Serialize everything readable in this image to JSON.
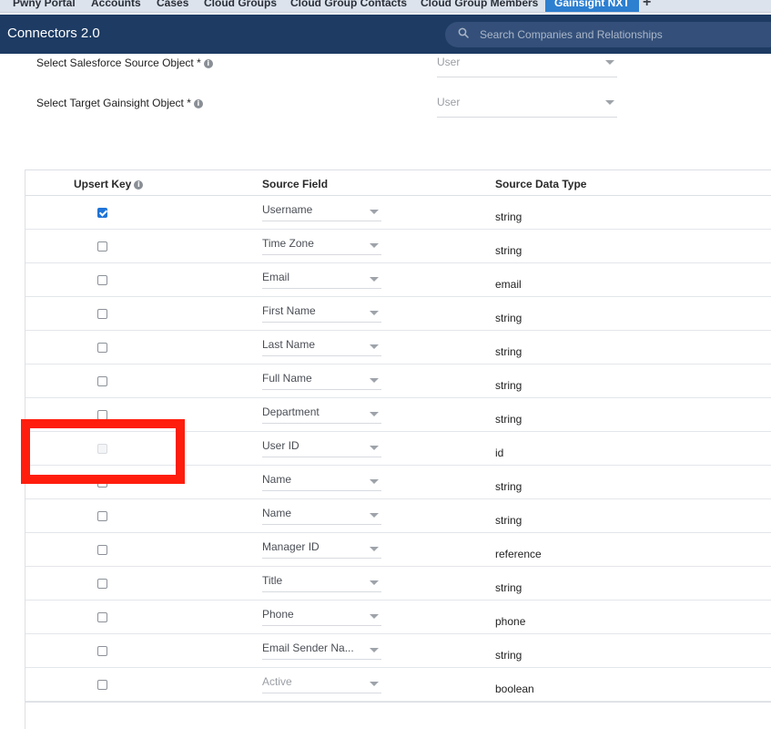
{
  "tabs": [
    {
      "label": "Pwny Portal",
      "active": false
    },
    {
      "label": "Accounts",
      "active": false
    },
    {
      "label": "Cases",
      "active": false
    },
    {
      "label": "Cloud Groups",
      "active": false
    },
    {
      "label": "Cloud Group Contacts",
      "active": false
    },
    {
      "label": "Cloud Group Members",
      "active": false
    },
    {
      "label": "Gainsight NXT",
      "active": true
    }
  ],
  "add_tab_label": "+",
  "header": {
    "title": "Connectors 2.0",
    "search_placeholder": "Search Companies and Relationships"
  },
  "source_object": {
    "label": "Select Salesforce Source Object *",
    "value": "User"
  },
  "target_object": {
    "label": "Select Target Gainsight Object *",
    "value": "User"
  },
  "info_glyph": "i",
  "table": {
    "columns": {
      "upsert_key": "Upsert Key",
      "source_field": "Source Field",
      "source_data_type": "Source Data Type"
    },
    "rows": [
      {
        "checked": true,
        "disabled": false,
        "field": "Username",
        "muted": false,
        "type": "string"
      },
      {
        "checked": false,
        "disabled": false,
        "field": "Time Zone",
        "muted": false,
        "type": "string"
      },
      {
        "checked": false,
        "disabled": false,
        "field": "Email",
        "muted": false,
        "type": "email"
      },
      {
        "checked": false,
        "disabled": false,
        "field": "First Name",
        "muted": false,
        "type": "string"
      },
      {
        "checked": false,
        "disabled": false,
        "field": "Last Name",
        "muted": false,
        "type": "string"
      },
      {
        "checked": false,
        "disabled": false,
        "field": "Full Name",
        "muted": false,
        "type": "string"
      },
      {
        "checked": false,
        "disabled": false,
        "field": "Department",
        "muted": false,
        "type": "string"
      },
      {
        "checked": false,
        "disabled": true,
        "field": "User ID",
        "muted": false,
        "type": "id"
      },
      {
        "checked": false,
        "disabled": false,
        "field": "Name",
        "muted": false,
        "type": "string"
      },
      {
        "checked": false,
        "disabled": false,
        "field": "Name",
        "muted": false,
        "type": "string"
      },
      {
        "checked": false,
        "disabled": false,
        "field": "Manager ID",
        "muted": false,
        "type": "reference"
      },
      {
        "checked": false,
        "disabled": false,
        "field": "Title",
        "muted": false,
        "type": "string"
      },
      {
        "checked": false,
        "disabled": false,
        "field": "Phone",
        "muted": false,
        "type": "phone"
      },
      {
        "checked": false,
        "disabled": false,
        "field": "Email Sender Na...",
        "muted": false,
        "type": "string"
      },
      {
        "checked": false,
        "disabled": false,
        "field": "Active",
        "muted": true,
        "type": "boolean"
      }
    ]
  },
  "colors": {
    "header_bg": "#1d3b63",
    "active_tab": "#2d7fd0",
    "checkbox_checked": "#1f74d8",
    "highlight": "#ff1d0d"
  }
}
